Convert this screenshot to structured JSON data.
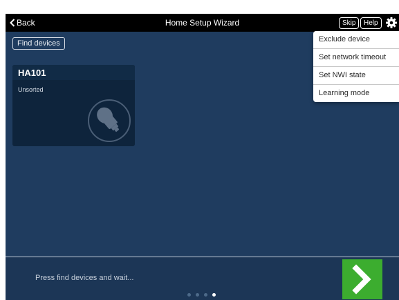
{
  "header": {
    "back_label": "Back",
    "title": "Home Setup Wizard",
    "skip_label": "Skip",
    "help_label": "Help"
  },
  "main": {
    "find_devices_label": "Find devices",
    "device_card": {
      "name": "HA101",
      "category": "Unsorted",
      "icon": "bulb-socket-icon"
    }
  },
  "menu": {
    "items": [
      {
        "label": "Exclude device"
      },
      {
        "label": "Set network timeout"
      },
      {
        "label": "Set NWI state"
      },
      {
        "label": "Learning mode"
      }
    ]
  },
  "footer": {
    "hint": "Press find devices and wait...",
    "pager": {
      "total": 4,
      "current": 4
    },
    "next_icon": "chevron-right-icon"
  },
  "colors": {
    "background": "#1f3c5f",
    "topbar": "#000000",
    "next_button": "#3cad2f",
    "card": "#0e243c"
  }
}
